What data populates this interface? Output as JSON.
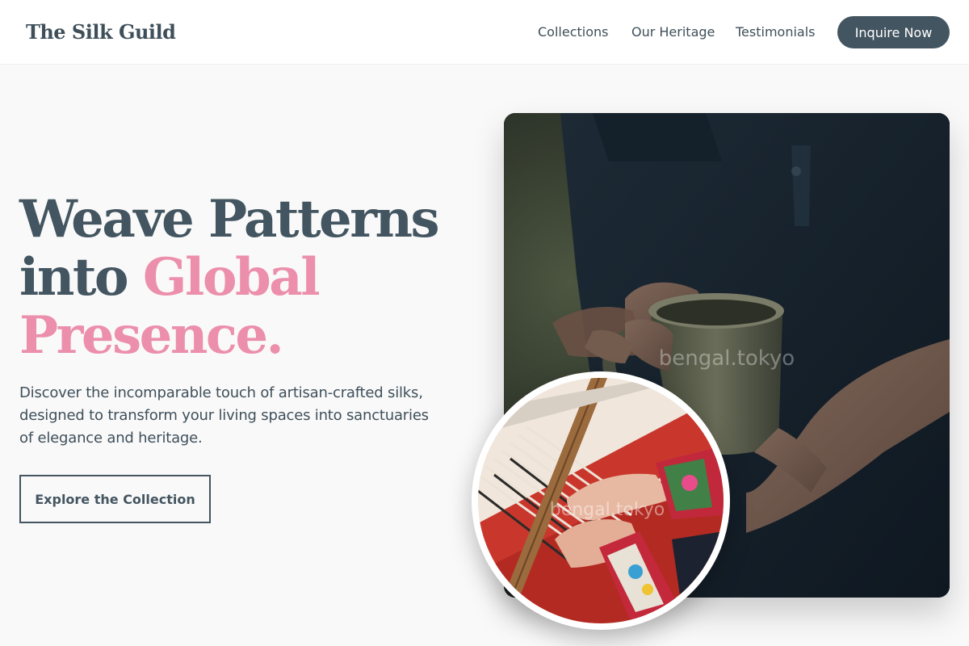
{
  "nav": {
    "brand": "The Silk Guild",
    "links": [
      "Collections",
      "Our Heritage",
      "Testimonials"
    ],
    "cta": "Inquire Now"
  },
  "hero": {
    "headline_line1": "Weave Patterns",
    "headline_line2_plain": "into ",
    "headline_line2_accent": "Global",
    "headline_line3_accent": "Presence.",
    "description": "Discover the incomparable touch of artisan-crafted silks, designed to transform your living spaces into sanctuaries of elegance and heritage.",
    "button": "Explore the Collection"
  },
  "images": {
    "main_watermark": "bengal.tokyo",
    "inset_watermark": "bengal.tokyo"
  },
  "colors": {
    "primary": "#435560",
    "accent": "#ec8fac",
    "background": "#f9f9f9"
  }
}
